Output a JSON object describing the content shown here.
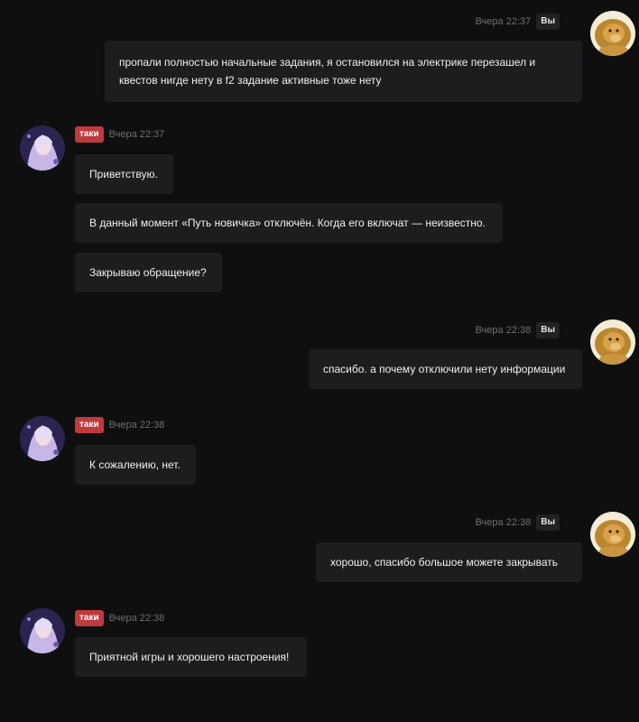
{
  "labels": {
    "me": "Вы",
    "operator": "таки"
  },
  "messages": [
    {
      "time": "Вчера 22:37",
      "text": "пропали полностью начальные задания, я остановился на электрике перезашел и квестов нигде нету в f2 задание активные тоже нету"
    },
    {
      "time": "Вчера 22:37",
      "lines": [
        "Приветствую.",
        "В данный момент «Путь новичка» отключён. Когда его включат — неизвестно.",
        "Закрываю обращение?"
      ]
    },
    {
      "time": "Вчера 22:38",
      "text": "спасибо. а почему отключили нету информации"
    },
    {
      "time": "Вчера 22:38",
      "text": "К сожалению, нет."
    },
    {
      "time": "Вчера 22:38",
      "text": "хорошо, спасибо большое можете закрывать"
    },
    {
      "time": "Вчера 22:38",
      "text": "Приятной игры и хорошего настроения!"
    }
  ],
  "colors": {
    "background": "#0f0f10",
    "bubble": "#1d1d20",
    "operator_tag": "#c0393b",
    "me_tag": "#222225"
  },
  "icons": {
    "me_avatar": "lion-avatar-icon",
    "operator_avatar": "anime-girl-avatar-icon"
  }
}
